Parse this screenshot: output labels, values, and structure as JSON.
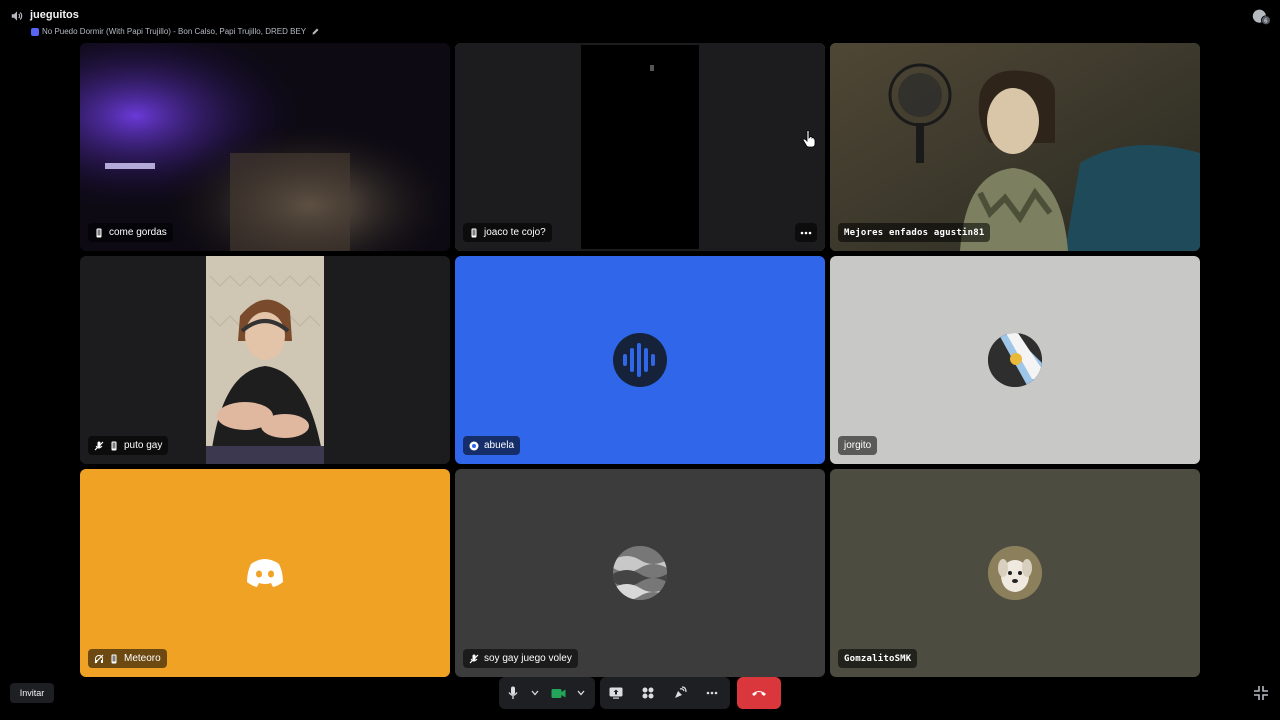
{
  "header": {
    "channel_name": "jueguitos",
    "activity_text": "No Puedo Dormir (With Papi Trujillo) - Bon Calso, Papi Trujillo, DRED BEY",
    "notification_badge": "6"
  },
  "tiles": [
    {
      "name": "come gordas",
      "type": "video",
      "device": "mobile"
    },
    {
      "name": "joaco te cojo?",
      "type": "video",
      "device": "mobile",
      "speaking": true
    },
    {
      "name": "Mejores enfados agustin81",
      "type": "video",
      "speaking": true
    },
    {
      "name": "puto gay",
      "type": "video",
      "device": "mobile",
      "muted": true
    },
    {
      "name": "abuela",
      "type": "avatar",
      "background": "#3067ea"
    },
    {
      "name": "jorgito",
      "type": "avatar",
      "background": "#c8c8c6"
    },
    {
      "name": "Meteoro",
      "type": "avatar",
      "background": "#f0a224",
      "muted": true,
      "device": "mobile"
    },
    {
      "name": "soy gay juego voley",
      "type": "avatar",
      "background": "#3c3c3c",
      "muted": true
    },
    {
      "name": "GomzalitoSMK",
      "type": "avatar",
      "background": "#4c4c41"
    }
  ],
  "footer": {
    "invite_label": "Invitar"
  },
  "colors": {
    "speaking_ring": "#3ba55d",
    "hangup": "#da373c",
    "camera_active": "#23a55a"
  }
}
